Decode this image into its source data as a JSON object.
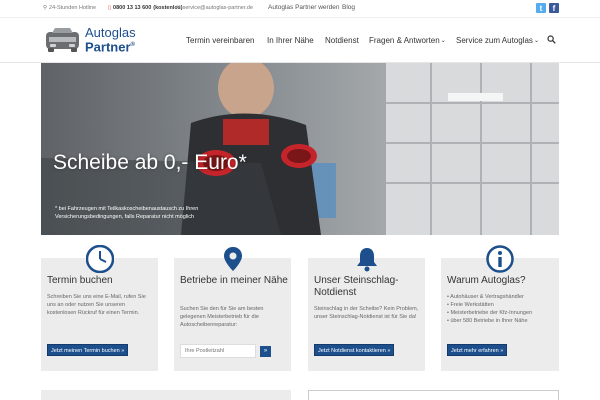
{
  "topbar": {
    "hours": "24-Stunden Hotline",
    "phone": "0800 13 13 600",
    "phone_note": "(kostenlos)",
    "email": "service@autoglas-partner.de",
    "links": [
      "Autoglas Partner werden",
      "Blog"
    ],
    "social": [
      {
        "name": "twitter-icon",
        "glyph": "t",
        "color": "#55acee"
      },
      {
        "name": "facebook-icon",
        "glyph": "f",
        "color": "#3b5998"
      }
    ]
  },
  "logo": {
    "line1": "Autoglas",
    "line2": "Partner",
    "mark": "®"
  },
  "nav": [
    {
      "label": "Termin vereinbaren"
    },
    {
      "label": "In Ihrer Nähe"
    },
    {
      "label": "Notdienst"
    },
    {
      "label": "Fragen & Antworten",
      "chevron": "⌄"
    },
    {
      "label": "Service zum Autoglas",
      "chevron": "⌄"
    }
  ],
  "hero": {
    "title": "Scheibe ab 0,- Euro*",
    "subtitle": "* bei Fahrzeugen mit Teilkaskoscheibenaustausch zu Ihren Versicherungsbedingungen, falls Reparatur nicht möglich"
  },
  "cards": [
    {
      "title": "Termin buchen",
      "body": "Schreiben Sie uns eine E-Mail, rufen Sie uns an oder nutzen Sie unseren kostenlosen Rückruf für einen Termin.",
      "button": "Jetzt meinen Termin buchen »",
      "icon": "clock-icon"
    },
    {
      "title": "Betriebe in meiner Nähe",
      "body": "Suchen Sie den für Sie am besten gelegenen Meisterbetrieb für die Autoscheibenreparatur:",
      "placeholder": "Ihre Postleitzahl",
      "button": "»",
      "icon": "map-pin-icon"
    },
    {
      "title": "Unser Steinschlag-Notdienst",
      "body": "Steinschlag in der Scheibe? Kein Problem, unser Steinschlag-Notdienst ist für Sie da!",
      "button": "Jetzt Notdienst kontaktieren »",
      "icon": "bell-icon"
    },
    {
      "title": "Warum Autoglas?",
      "items": [
        "• Autohäuser & Vertragshändler",
        "• Freie Werkstätten",
        "• Meisterbetriebe der Kfz-Innungen",
        "• über 580 Betriebe in Ihrer Nähe"
      ],
      "button": "Jetzt mehr erfahren »",
      "icon": "info-icon"
    }
  ],
  "colors": {
    "brand": "#1c4f8c",
    "accent": "#d33"
  }
}
